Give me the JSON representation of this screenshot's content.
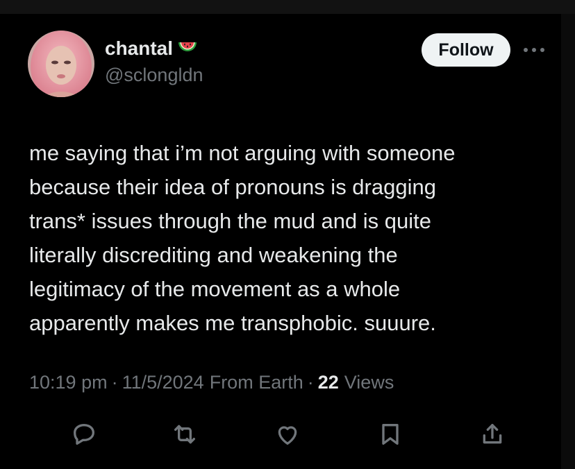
{
  "user": {
    "display_name": "chantal",
    "name_emoji": "watermelon-icon",
    "handle": "@sclongldn"
  },
  "header": {
    "follow_label": "Follow",
    "more_icon": "more-dots-icon"
  },
  "tweet": {
    "text": "me saying that i’m not arguing with someone\nbecause their idea of pronouns is dragging\ntrans* issues through the mud and is quite\nliterally discrediting and weakening the\nlegitimacy of the movement as a whole\napparently makes me transphobic. suuure."
  },
  "meta": {
    "time": "10:19 pm",
    "date": "11/5/2024",
    "source": "From Earth",
    "separator": "·",
    "views_count": "22",
    "views_label": "Views"
  },
  "actions": [
    "reply-icon",
    "retweet-icon",
    "like-icon",
    "bookmark-icon",
    "share-icon"
  ],
  "colors": {
    "background": "#000000",
    "text_primary": "#e7e9ea",
    "text_secondary": "#71767b",
    "follow_bg": "#eff3f4"
  }
}
